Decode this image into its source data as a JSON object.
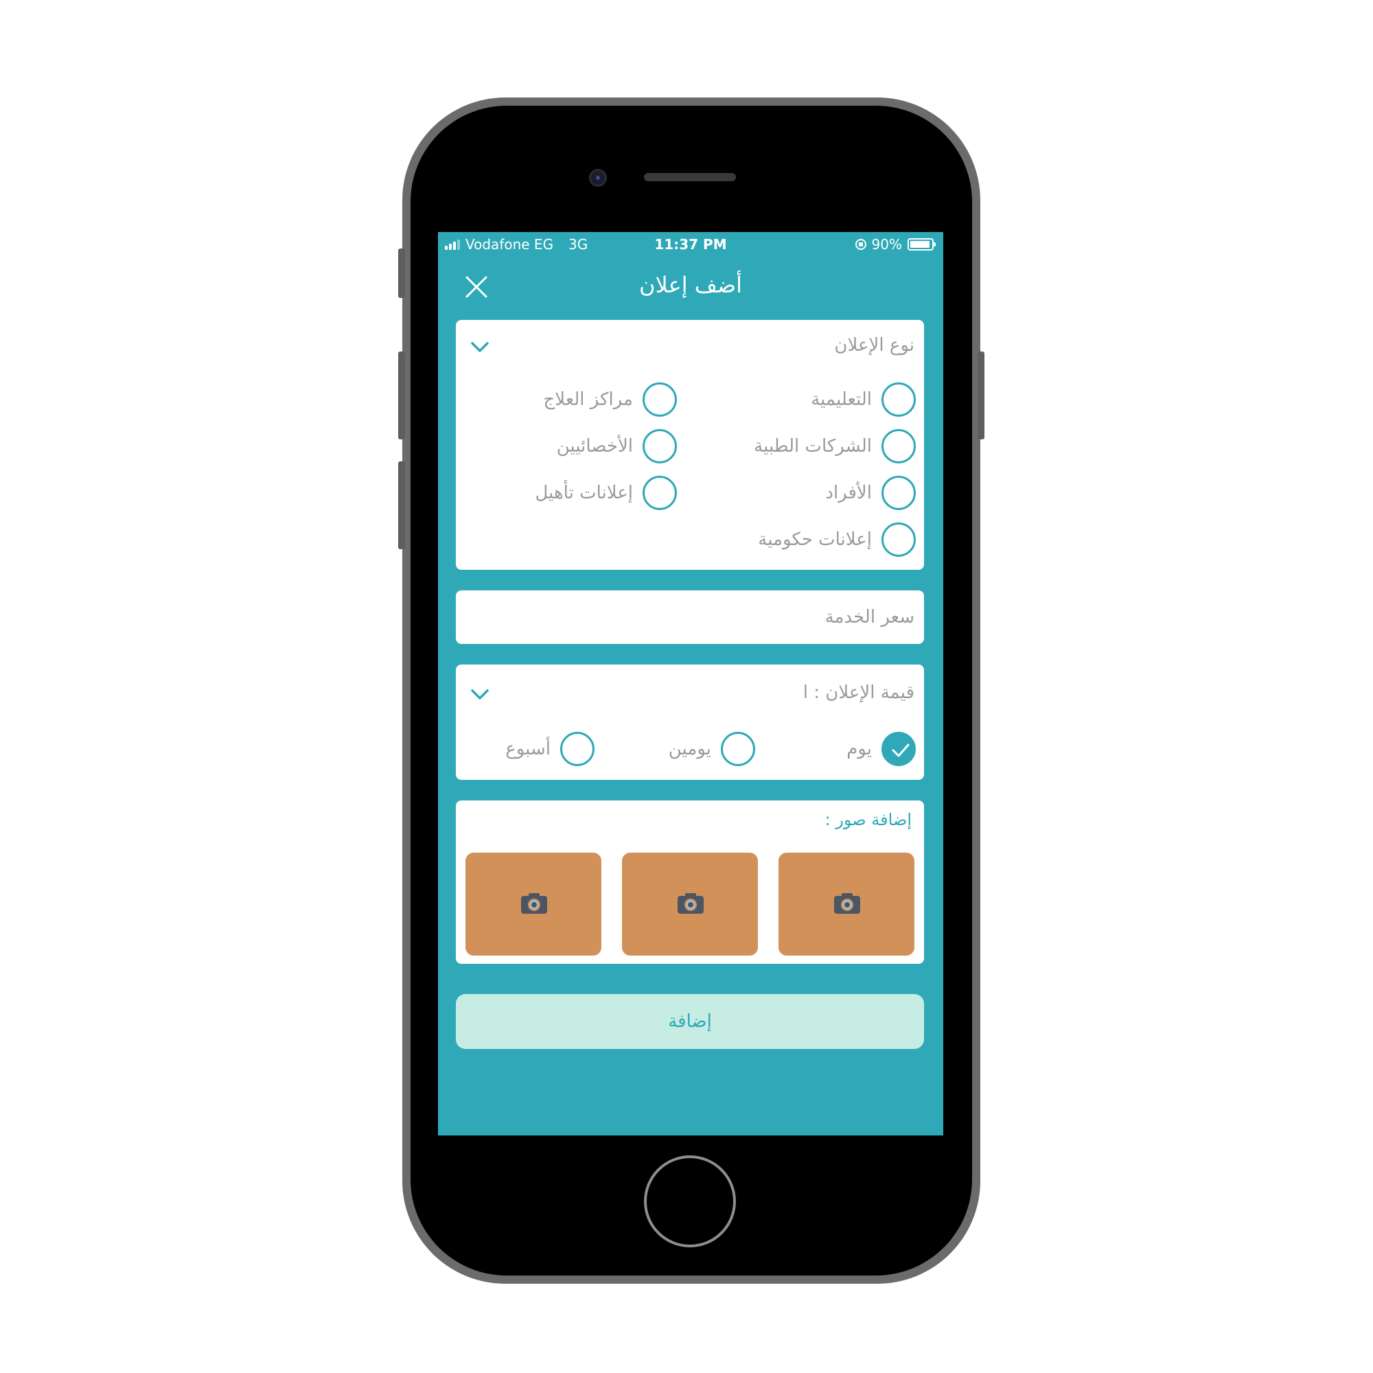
{
  "status_bar": {
    "carrier": "Vodafone EG",
    "network": "3G",
    "time": "11:37 PM",
    "battery": "90%"
  },
  "header": {
    "title": "أضف إعلان",
    "close_icon": "close-icon"
  },
  "ad_type": {
    "label": "نوع الإعلان",
    "options": [
      {
        "label": "التعليمية",
        "checked": false
      },
      {
        "label": "مراكز العلاج",
        "checked": false
      },
      {
        "label": "الشركات الطبية",
        "checked": false
      },
      {
        "label": "الأخصائيين",
        "checked": false
      },
      {
        "label": "الأفراد",
        "checked": false
      },
      {
        "label": "إعلانات تأهيل",
        "checked": false
      },
      {
        "label": "إعلانات حكومية",
        "checked": false
      }
    ]
  },
  "service_price": {
    "placeholder": "سعر الخدمة",
    "value": ""
  },
  "ad_value": {
    "label": "قيمة الإعلان : ا",
    "options": [
      {
        "label": "يوم",
        "checked": true
      },
      {
        "label": "يومين",
        "checked": false
      },
      {
        "label": "أسبوع",
        "checked": false
      }
    ]
  },
  "photos": {
    "label": "إضافة صور :",
    "slot_icon": "camera-icon",
    "slot_count": 3
  },
  "submit": {
    "label": "إضافة"
  },
  "colors": {
    "primary": "#2fa9b7",
    "photo_slot": "#d29159",
    "submit_bg": "#c7ece4"
  }
}
